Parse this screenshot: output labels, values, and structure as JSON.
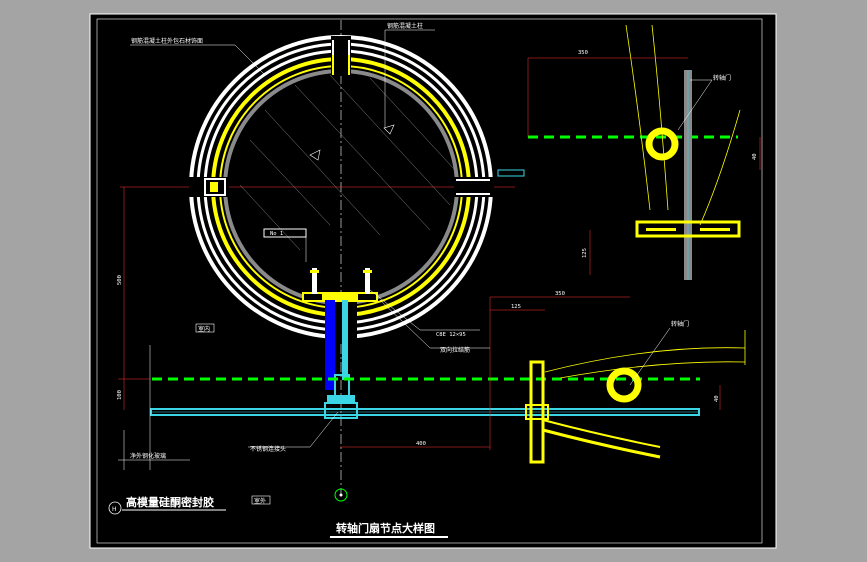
{
  "labels": {
    "top_left_note": "钢筋混凝土柱外包石材饰面",
    "top_mid_note": "钢筋混凝土柱",
    "pivot_door_top": "转轴门",
    "pivot_door_bottom": "转轴门",
    "section_tag": "No 1",
    "bolt_spec": "C8E 12×95",
    "anchor_note": "双向拉结筋",
    "indoor_left": "室内",
    "indoor_right": "室外",
    "steel_joint": "不锈钢连接头",
    "floor_note": "净外钢化玻璃",
    "sealant_note": "高模量硅酮密封胶",
    "title": "转轴门扇节点大样图",
    "marker_letter": "H"
  },
  "dimensions": {
    "top_350": "350",
    "right_40": "40",
    "right_125": "125",
    "left_500": "500",
    "left_100": "100",
    "mid_125": "125",
    "mid_350": "350",
    "mid_400": "400",
    "right_bottom_40": "40"
  },
  "colors": {
    "background": "#a4a4a4",
    "sheet": "#000000",
    "yellow": "#ffff00",
    "green": "#00ff00",
    "cyan": "#3ad6e6",
    "blue": "#0000ff",
    "red": "#ff3030",
    "grey": "#8a8a8a"
  }
}
